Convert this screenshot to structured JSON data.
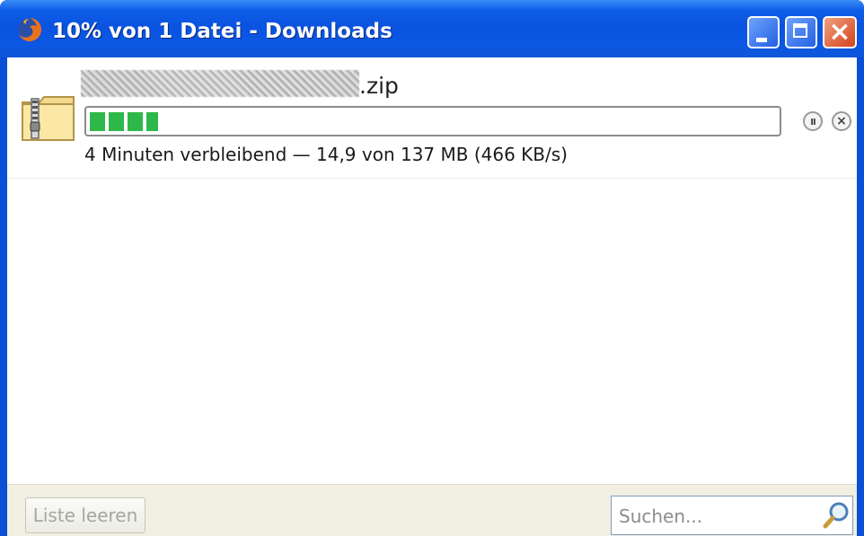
{
  "window": {
    "title": "10% von 1 Datei - Downloads",
    "close_glyph": "×"
  },
  "download": {
    "filename_suffix": ".zip",
    "progress_percent": 10,
    "status_text": "4 Minuten verbleibend — 14,9 von 137 MB (466 KB/s)",
    "pause_glyph": "II",
    "cancel_glyph": "×"
  },
  "footer": {
    "clear_list_label": "Liste leeren",
    "search_placeholder": "Suchen..."
  },
  "icons": {
    "app": "firefox-icon",
    "file": "zip-folder-icon",
    "pause": "pause-icon",
    "cancel": "cancel-icon",
    "search": "magnifier-icon"
  },
  "colors": {
    "titlebar": "#0a53e0",
    "progress": "#2fb84a",
    "footer": "#f1efe2"
  }
}
